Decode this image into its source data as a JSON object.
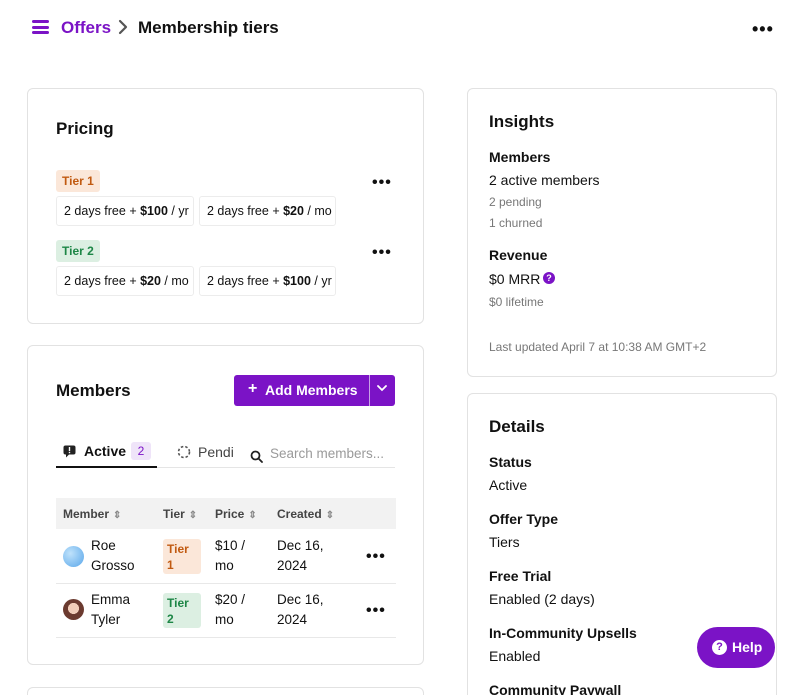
{
  "breadcrumb": {
    "parent": "Offers",
    "current": "Membership tiers"
  },
  "pricing": {
    "title": "Pricing",
    "tiers": [
      {
        "name": "Tier 1",
        "options": [
          {
            "prefix": "2 days free + ",
            "amount": "$100",
            "period": " / yr"
          },
          {
            "prefix": "2 days free + ",
            "amount": "$20",
            "period": " / mo"
          }
        ]
      },
      {
        "name": "Tier 2",
        "options": [
          {
            "prefix": "2 days free + ",
            "amount": "$20",
            "period": " / mo"
          },
          {
            "prefix": "2 days free + ",
            "amount": "$100",
            "period": " / yr"
          }
        ]
      }
    ]
  },
  "members": {
    "title": "Members",
    "add_button": "Add Members",
    "tabs": {
      "active": "Active",
      "active_count": "2",
      "pending": "Pending"
    },
    "search_placeholder": "Search members...",
    "columns": [
      "Member",
      "Tier",
      "Price",
      "Created"
    ],
    "rows": [
      {
        "name_first": "Roe",
        "name_last": "Grosso",
        "tier_word": "Tier",
        "tier_num": "1",
        "price_amt": "$10 /",
        "price_per": "mo",
        "created_date": "Dec 16,",
        "created_year": "2024"
      },
      {
        "name_first": "Emma",
        "name_last": "Tyler",
        "tier_word": "Tier",
        "tier_num": "2",
        "price_amt": "$20 /",
        "price_per": "mo",
        "created_date": "Dec 16,",
        "created_year": "2024"
      }
    ]
  },
  "insights": {
    "title": "Insights",
    "members_label": "Members",
    "active_members": "2 active members",
    "pending": "2 pending",
    "churned": "1 churned",
    "revenue_label": "Revenue",
    "mrr": "$0 MRR",
    "lifetime": "$0 lifetime",
    "last_updated": "Last updated April 7 at 10:38 AM GMT+2"
  },
  "details": {
    "title": "Details",
    "status_label": "Status",
    "status_value": "Active",
    "offer_type_label": "Offer Type",
    "offer_type_value": "Tiers",
    "free_trial_label": "Free Trial",
    "free_trial_value": "Enabled (2 days)",
    "upsells_label": "In-Community Upsells",
    "upsells_value": "Enabled",
    "paywall_label": "Community Paywall"
  },
  "help_button": "Help",
  "colors": {
    "accent": "#7b13c6",
    "tier1_bg": "#fbe7d9",
    "tier1_text": "#c15a11",
    "tier2_bg": "#dcefe2",
    "tier2_text": "#1d8646"
  },
  "icons": [
    "menu-icon",
    "chevron-right-icon",
    "more-icon",
    "plus-icon",
    "chevron-down-icon",
    "active-members-icon",
    "pending-spinner-icon",
    "search-icon",
    "sort-icon",
    "question-icon"
  ]
}
